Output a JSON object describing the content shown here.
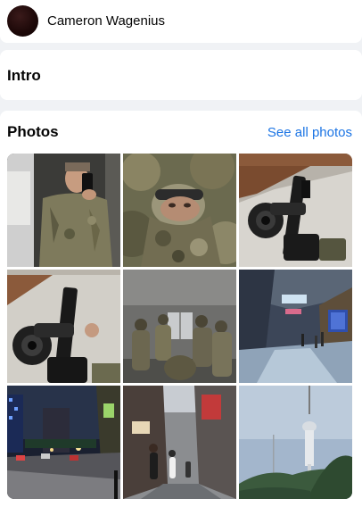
{
  "profile": {
    "name": "Cameron Wagenius"
  },
  "intro": {
    "title": "Intro"
  },
  "photos": {
    "title": "Photos",
    "see_all_label": "See all photos",
    "items": [
      {
        "subject": "mirror-selfie-soldier"
      },
      {
        "subject": "camouflaged-face"
      },
      {
        "subject": "rifle-with-optics"
      },
      {
        "subject": "rifle-closeup"
      },
      {
        "subject": "soldiers-in-room"
      },
      {
        "subject": "mall-interior"
      },
      {
        "subject": "city-street-night"
      },
      {
        "subject": "alley-street"
      },
      {
        "subject": "tower-on-hill"
      }
    ]
  },
  "colors": {
    "link": "#1b74e4",
    "page_background": "#f0f2f5",
    "card_background": "#ffffff"
  }
}
